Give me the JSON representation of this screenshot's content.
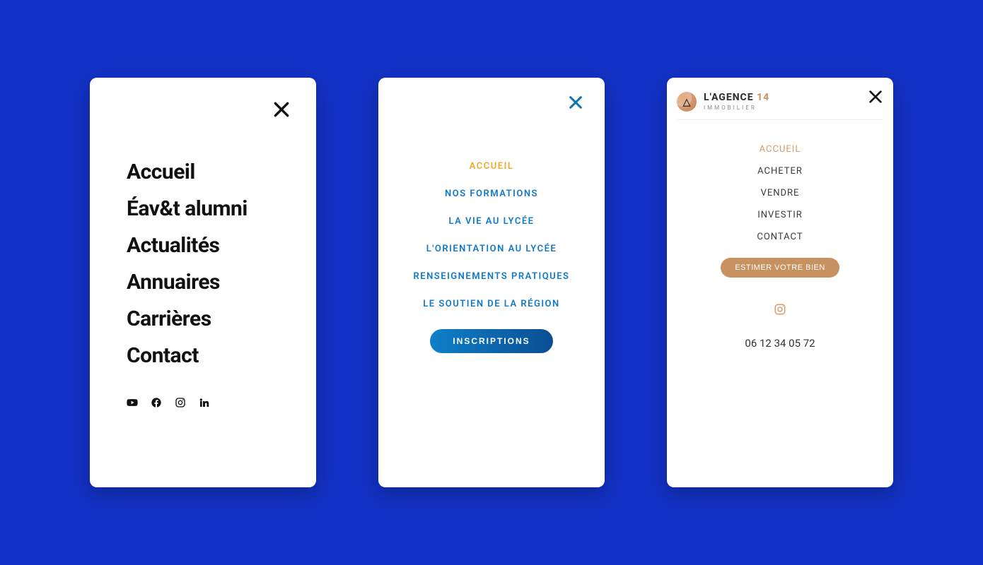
{
  "card1": {
    "nav": [
      "Accueil",
      "Éav&t alumni",
      "Actualités",
      "Annuaires",
      "Carrières",
      "Contact"
    ],
    "social": [
      "youtube",
      "facebook",
      "instagram",
      "linkedin"
    ]
  },
  "card2": {
    "nav": [
      {
        "label": "ACCUEIL",
        "accent": true
      },
      {
        "label": "NOS FORMATIONS"
      },
      {
        "label": "LA VIE AU LYCÉE"
      },
      {
        "label": "L'ORIENTATION AU LYCÉE"
      },
      {
        "label": "RENSEIGNEMENTS PRATIQUES"
      },
      {
        "label": "LE SOUTIEN DE LA RÉGION"
      }
    ],
    "cta": "INSCRIPTIONS"
  },
  "card3": {
    "brand": {
      "name": "L'AGENCE",
      "number": "14",
      "sub": "IMMOBILIER"
    },
    "nav": [
      {
        "label": "ACCUEIL",
        "accent": true
      },
      {
        "label": "ACHETER"
      },
      {
        "label": "VENDRE"
      },
      {
        "label": "INVESTIR"
      },
      {
        "label": "CONTACT"
      }
    ],
    "cta": "ESTIMER VOTRE BIEN",
    "phone": "06 12 34 05 72"
  }
}
